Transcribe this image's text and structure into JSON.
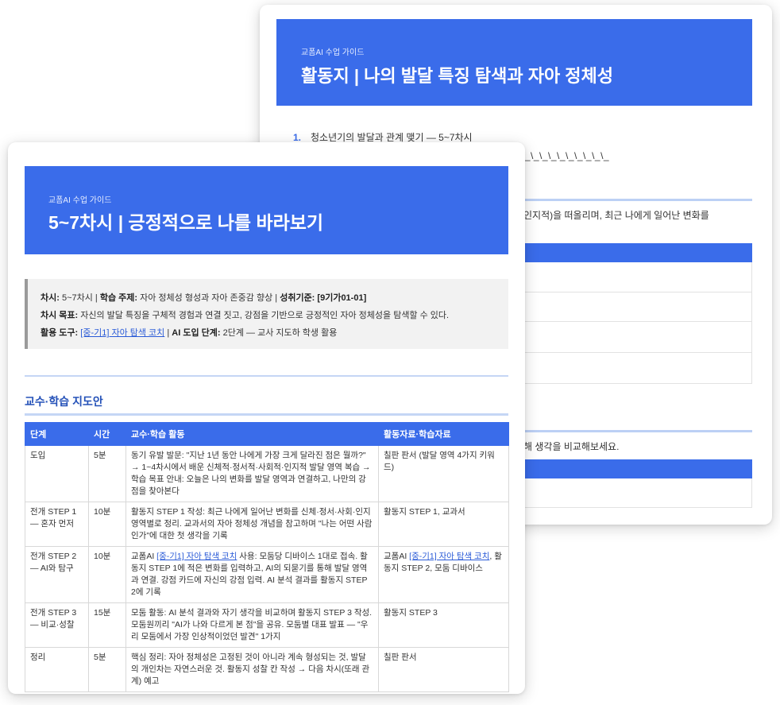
{
  "back_card": {
    "kicker": "교폼AI 수업 가이드",
    "title": "활동지 | 나의 발달 특징 탐색과 자아 정체성",
    "list_item_number": "1.",
    "list_item_text": "청소년기의 발달과 관계 맺기 — 5~7차시",
    "underline_fill": "\\_\\_\\_\\_\\_\\_\\_\\_\\_\\_",
    "partial_text_1": "인지적)을 떠올리며, 최근 나에게 일어난 변화를",
    "partial_text_2": "해 생각을 비교해보세요."
  },
  "front_card": {
    "kicker": "교폼AI 수업 가이드",
    "title": "5~7차시 | 긍정적으로 나를 바라보기",
    "info": {
      "session_label": "차시:",
      "session_value": "5~7차시",
      "topic_label": "학습 주제:",
      "topic_value": "자아 정체성 형성과 자아 존중감 향상",
      "standard_label": "성취기준:",
      "standard_value": "[9기가01-01]",
      "goal_label": "차시 목표:",
      "goal_value": "자신의 발달 특징을 구체적 경험과 연결 짓고, 강점을 기반으로 긍정적인 자아 정체성을 탐색할 수 있다.",
      "tool_label": "활용 도구:",
      "tool_link": "[중-기1] 자아 탐색 코치",
      "stage_label": "AI 도입 단계:",
      "stage_value": "2단계 — 교사 지도하 학생 활용"
    },
    "section_title": "교수·학습 지도안",
    "table": {
      "headers": [
        "단계",
        "시간",
        "교수·학습 활동",
        "활동자료·학습자료"
      ],
      "rows": [
        {
          "stage": "도입",
          "time": "5분",
          "activity": "동기 유발 발문: \"지난 1년 동안 나에게 가장 크게 달라진 점은 뭘까?\" → 1~4차시에서 배운 신체적·정서적·사회적·인지적 발달 영역 복습 → 학습 목표 안내: 오늘은 나의 변화를 발달 영역과 연결하고, 나만의 강점을 찾아본다",
          "materials": "칠판 판서 (발달 영역 4가지 키워드)"
        },
        {
          "stage": "전개 STEP 1 — 혼자 먼저",
          "time": "10분",
          "activity": "활동지 STEP 1 작성: 최근 나에게 일어난 변화를 신체·정서·사회·인지 영역별로 정리. 교과서의 자아 정체성 개념을 참고하며 \"나는 어떤 사람인가\"에 대한 첫 생각을 기록",
          "materials": "활동지 STEP 1, 교과서"
        },
        {
          "stage": "전개 STEP 2 — AI와 탐구",
          "time": "10분",
          "activity_pre": "교폼AI ",
          "activity_link": "[중-기1] 자아 탐색 코치",
          "activity_post": " 사용: 모둠당 디바이스 1대로 접속. 활동지 STEP 1에 적은 변화를 입력하고, AI의 되묻기를 통해 발달 영역과 연결. 강점 카드에 자신의 강점 입력. AI 분석 결과를 활동지 STEP 2에 기록",
          "materials_pre": "교폼AI ",
          "materials_link": "[중-기1] 자아 탐색 코치",
          "materials_post": ", 활동지 STEP 2, 모둠 디바이스"
        },
        {
          "stage": "전개 STEP 3 — 비교·성찰",
          "time": "15분",
          "activity": "모둠 활동: AI 분석 결과와 자기 생각을 비교하며 활동지 STEP 3 작성. 모둠원끼리 \"AI가 나와 다르게 본 점\"을 공유. 모둠별 대표 발표 — \"우리 모둠에서 가장 인상적이었던 발견\" 1가지",
          "materials": "활동지 STEP 3"
        },
        {
          "stage": "정리",
          "time": "5분",
          "activity": "핵심 정리: 자아 정체성은 고정된 것이 아니라 계속 형성되는 것, 발달의 개인차는 자연스러운 것. 활동지 성찰 칸 작성 → 다음 차시(또래 관계) 예고",
          "materials": "칠판 판서"
        }
      ]
    }
  },
  "colors": {
    "accent": "#3a6cea",
    "section_title": "#2451b8",
    "link": "#2a5bd7",
    "info_bg": "#f2f2f2"
  }
}
